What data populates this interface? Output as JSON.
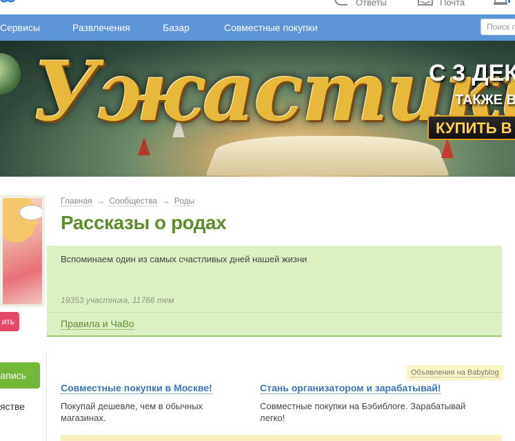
{
  "topbar": {
    "answers_label": "Ответы",
    "mail_label": "Почта"
  },
  "nav": {
    "items": [
      {
        "label": "Сервисы"
      },
      {
        "label": "Развлечения"
      },
      {
        "label": "Базар"
      },
      {
        "label": "Совместные покупки"
      }
    ],
    "search_placeholder": "Поиск п"
  },
  "banner": {
    "title": "Ужастики",
    "promo_line1": "С 3 ДЕК",
    "promo_line2": "ТАКЖЕ В",
    "buy_label": "КУПИТЬ В"
  },
  "sidebar": {
    "join_label": "ить",
    "write_label": "апись",
    "text_fragment": "ястве"
  },
  "breadcrumb": {
    "items": [
      "Главная",
      "Сообщества",
      "Роды"
    ],
    "separator": "→"
  },
  "community": {
    "title": "Рассказы о родах",
    "description": "Вспоминаем один из самых счастливых дней нашей жизни",
    "stats": "19353 участника, 11766 тем",
    "rules_link": "Правила и ЧаВо"
  },
  "ads": {
    "label": "Объявления на Babyblog",
    "items": [
      {
        "title": "Совместные покупки в Москве!",
        "text": "Покупай дешевле, чем в обычных магазинах."
      },
      {
        "title": "Стань организатором и зарабатывай!",
        "text": "Совместные покупки на Бэбиблоге. Зарабатывай легко!"
      }
    ]
  },
  "colors": {
    "nav_bg": "#5b95d8",
    "title_green": "#5f8b2e",
    "box_green": "#dcf0c4",
    "link_blue": "#3b73b5",
    "join_pink": "#e2486a",
    "write_green": "#74b83a"
  },
  "icons": {
    "answers": "speech-bubble-icon",
    "mail": "envelope-icon",
    "notify": "bell-icon"
  }
}
